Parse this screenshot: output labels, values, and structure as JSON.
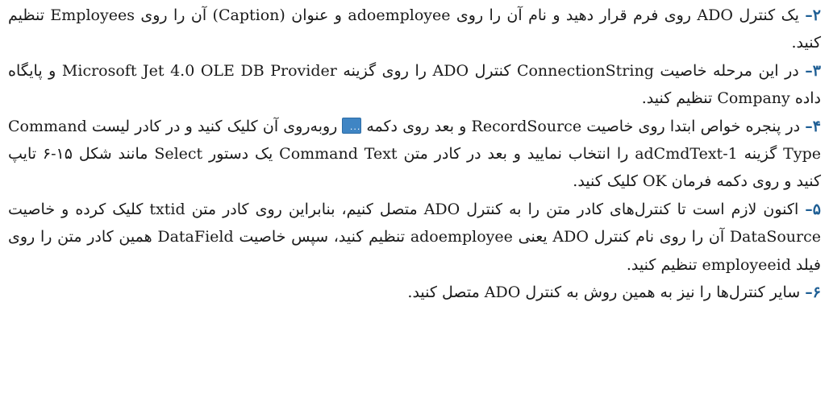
{
  "steps": [
    {
      "number": "۲",
      "text": "یک کنترل ADO روی فرم قرار دهید و نام آن را روی adoemployee و عنوان (Caption) آن را روی Employees تنظیم کنید."
    },
    {
      "number": "۳",
      "text": "در این مرحله خاصیت ConnectionString کنترل ADO را روی گزینه Microsoft Jet 4.0 OLE DB Provider و پایگاه داده Company تنظیم کنید."
    },
    {
      "number": "۴",
      "text_before": "در پنجره خواص ابتدا روی خاصیت RecordSource و بعد روی دکمه",
      "button_dots": "...",
      "text_after": "روبه‌روی آن کلیک کنید و در کادر لیست Command Type گزینه 1-adCmdText را انتخاب نمایید و بعد در کادر متن Command Text یک دستور Select مانند شکل ۱۵-۶ تایپ کنید و روی دکمه فرمان OK کلیک کنید."
    },
    {
      "number": "۵",
      "text": "اکنون لازم است تا کنترل‌های کادر متن را به کنترل ADO متصل کنیم، بنابراین روی کادر متن txtid کلیک کرده و خاصیت DataSource آن را روی نام کنترل ADO یعنی adoemployee تنظیم کنید، سپس خاصیت DataField همین کادر متن را روی فیلد employeeid تنظیم کنید."
    },
    {
      "number": "۶",
      "text": "سایر کنترل‌ها را نیز به همین روش به کنترل ADO متصل کنید."
    }
  ],
  "separator": "–",
  "colors": {
    "step_number": "#1f5f95",
    "body_text": "#1a1a1a",
    "button_fill": "#3f85c4"
  }
}
